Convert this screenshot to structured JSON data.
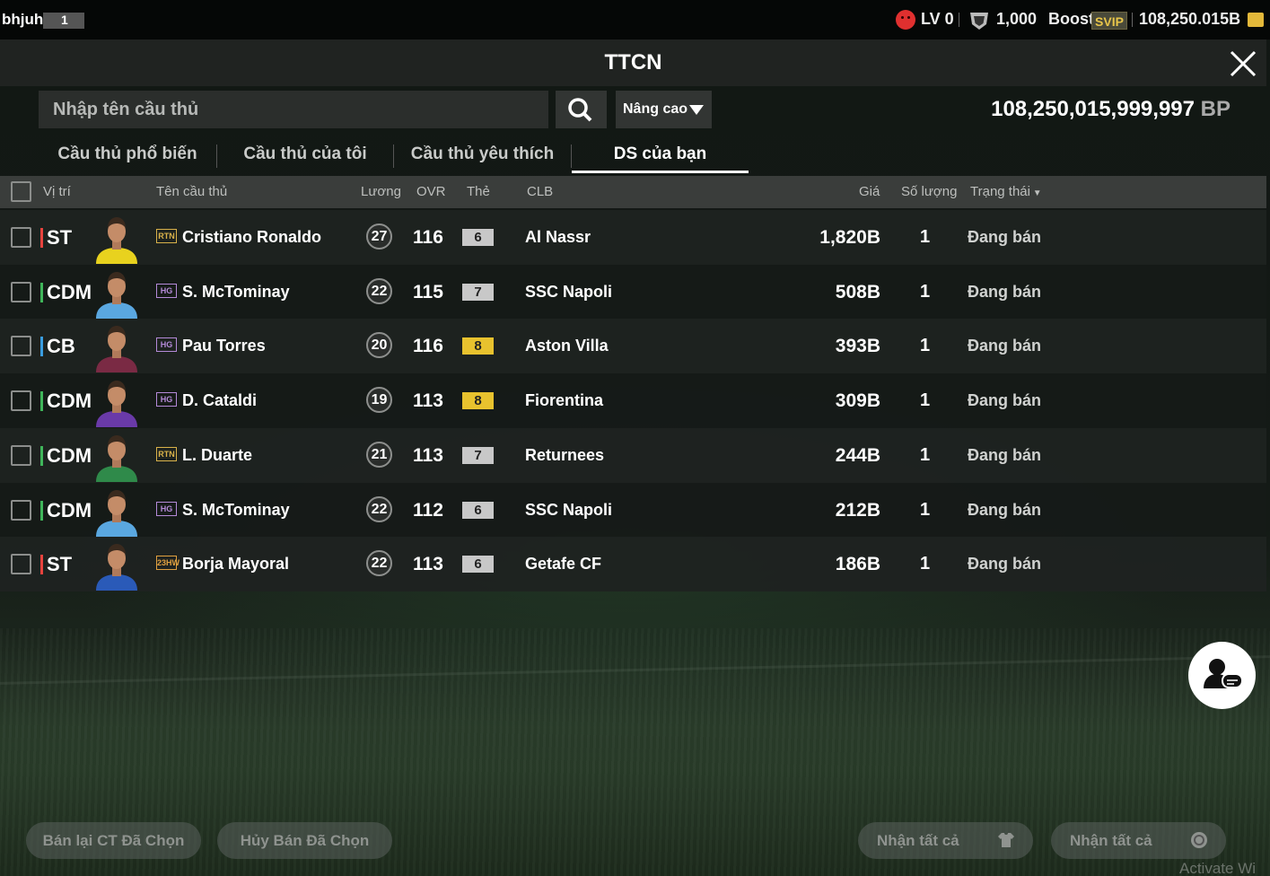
{
  "topbar": {
    "username": "bhjuh",
    "level_badge": "1",
    "lv": "LV 0",
    "shield_value": "1,000",
    "boost": "Boost",
    "svip": "SVIP",
    "coins": "108,250.015B"
  },
  "header": {
    "title": "TTCN"
  },
  "search": {
    "placeholder": "Nhập tên cầu thủ",
    "advanced": "Nâng cao"
  },
  "balance": {
    "amount": "108,250,015,999,997",
    "unit": "BP"
  },
  "tabs": [
    "Cầu thủ phổ biến",
    "Cầu thủ của tôi",
    "Cầu thủ yêu thích",
    "DS của bạn"
  ],
  "active_tab": "DS của bạn",
  "columns": {
    "position": "Vị trí",
    "name": "Tên cầu thủ",
    "salary": "Lương",
    "ovr": "OVR",
    "card": "Thẻ",
    "club": "CLB",
    "price": "Giá",
    "quantity": "Số lượng",
    "status": "Trạng thái"
  },
  "rows": [
    {
      "position": "ST",
      "pos_color": "#e8433e",
      "badge": "RTN",
      "badge_color": "#d9b24a",
      "name": "Cristiano Ronaldo",
      "salary": "27",
      "ovr": "116",
      "card": "6",
      "card_color": "#c8c8c8",
      "club": "Al Nassr",
      "price": "1,820B",
      "quantity": "1",
      "status": "Đang bán",
      "kit": "#e8d21e"
    },
    {
      "position": "CDM",
      "pos_color": "#3fb55a",
      "badge": "HG",
      "badge_color": "#b48ad8",
      "name": "S. McTominay",
      "salary": "22",
      "ovr": "115",
      "card": "7",
      "card_color": "#c8c8c8",
      "club": "SSC Napoli",
      "price": "508B",
      "quantity": "1",
      "status": "Đang bán",
      "kit": "#5aa7e0"
    },
    {
      "position": "CB",
      "pos_color": "#3a9de0",
      "badge": "HG",
      "badge_color": "#b48ad8",
      "name": "Pau Torres",
      "salary": "20",
      "ovr": "116",
      "card": "8",
      "card_color": "#e8c22e",
      "club": "Aston Villa",
      "price": "393B",
      "quantity": "1",
      "status": "Đang bán",
      "kit": "#7a2a44"
    },
    {
      "position": "CDM",
      "pos_color": "#3fb55a",
      "badge": "HG",
      "badge_color": "#b48ad8",
      "name": "D. Cataldi",
      "salary": "19",
      "ovr": "113",
      "card": "8",
      "card_color": "#e8c22e",
      "club": "Fiorentina",
      "price": "309B",
      "quantity": "1",
      "status": "Đang bán",
      "kit": "#6a3aa8"
    },
    {
      "position": "CDM",
      "pos_color": "#3fb55a",
      "badge": "RTN",
      "badge_color": "#d9b24a",
      "name": "L. Duarte",
      "salary": "21",
      "ovr": "113",
      "card": "7",
      "card_color": "#c8c8c8",
      "club": "Returnees",
      "price": "244B",
      "quantity": "1",
      "status": "Đang bán",
      "kit": "#2f8a4a"
    },
    {
      "position": "CDM",
      "pos_color": "#3fb55a",
      "badge": "HG",
      "badge_color": "#b48ad8",
      "name": "S. McTominay",
      "salary": "22",
      "ovr": "112",
      "card": "6",
      "card_color": "#c8c8c8",
      "club": "SSC Napoli",
      "price": "212B",
      "quantity": "1",
      "status": "Đang bán",
      "kit": "#5aa7e0"
    },
    {
      "position": "ST",
      "pos_color": "#e8433e",
      "badge": "23HW",
      "badge_color": "#e0a040",
      "name": "Borja Mayoral",
      "salary": "22",
      "ovr": "113",
      "card": "6",
      "card_color": "#c8c8c8",
      "club": "Getafe CF",
      "price": "186B",
      "quantity": "1",
      "status": "Đang bán",
      "kit": "#2a5ab8"
    }
  ],
  "buttons": {
    "resell": "Bán lại CT Đã Chọn",
    "cancel": "Hủy Bán Đã Chọn",
    "claim_all_1": "Nhận tất cả",
    "claim_all_2": "Nhận tất cả"
  },
  "watermark": "Activate Wi"
}
